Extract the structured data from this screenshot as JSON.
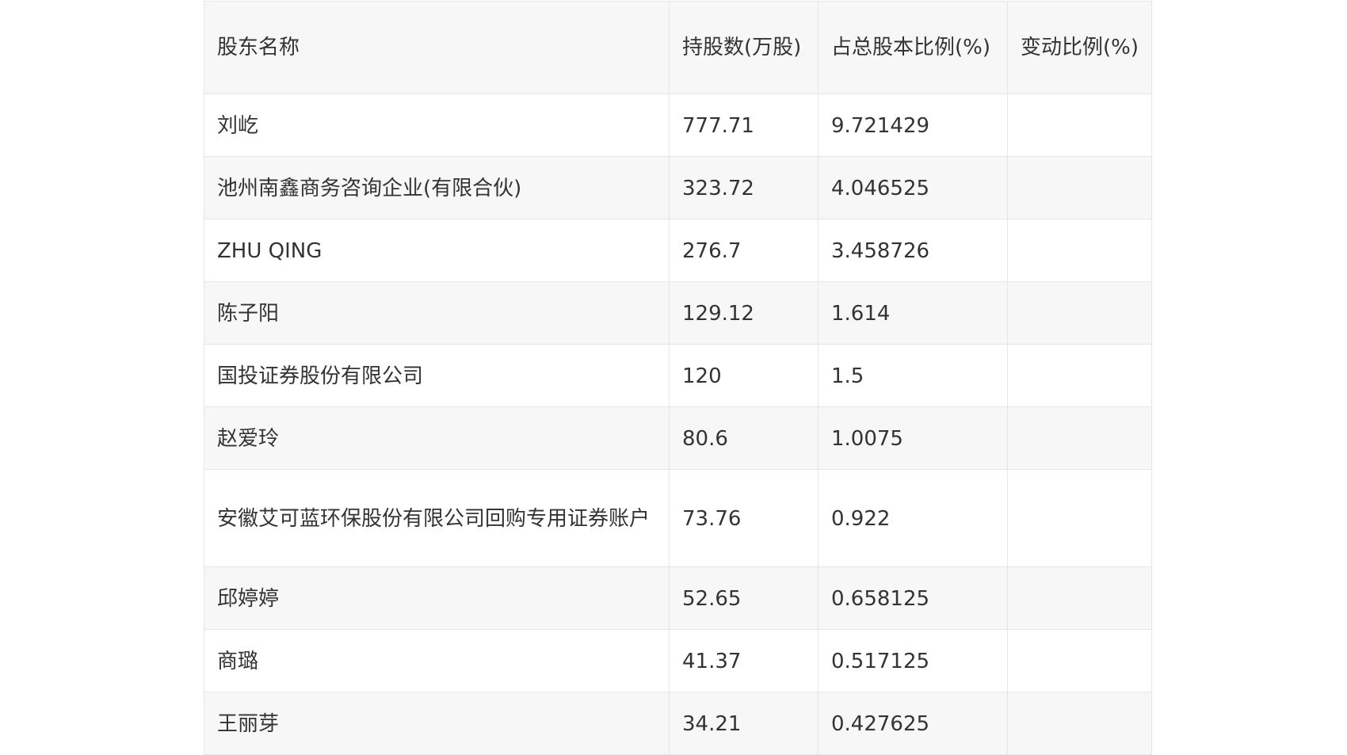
{
  "table": {
    "headers": [
      "股东名称",
      "持股数(万股)",
      "占总股本比例(%)",
      "变动比例(%)"
    ],
    "rows": [
      {
        "name": "刘屹",
        "shares": "777.71",
        "ratio": "9.721429",
        "change": ""
      },
      {
        "name": "池州南鑫商务咨询企业(有限合伙)",
        "shares": "323.72",
        "ratio": "4.046525",
        "change": ""
      },
      {
        "name": "ZHU QING",
        "shares": "276.7",
        "ratio": "3.458726",
        "change": ""
      },
      {
        "name": "陈子阳",
        "shares": "129.12",
        "ratio": "1.614",
        "change": ""
      },
      {
        "name": "国投证券股份有限公司",
        "shares": "120",
        "ratio": "1.5",
        "change": ""
      },
      {
        "name": "赵爱玲",
        "shares": "80.6",
        "ratio": "1.0075",
        "change": ""
      },
      {
        "name": "安徽艾可蓝环保股份有限公司回购专用证券账户",
        "shares": "73.76",
        "ratio": "0.922",
        "change": ""
      },
      {
        "name": "邱婷婷",
        "shares": "52.65",
        "ratio": "0.658125",
        "change": ""
      },
      {
        "name": "商璐",
        "shares": "41.37",
        "ratio": "0.517125",
        "change": ""
      },
      {
        "name": "王丽芽",
        "shares": "34.21",
        "ratio": "0.427625",
        "change": ""
      }
    ]
  }
}
